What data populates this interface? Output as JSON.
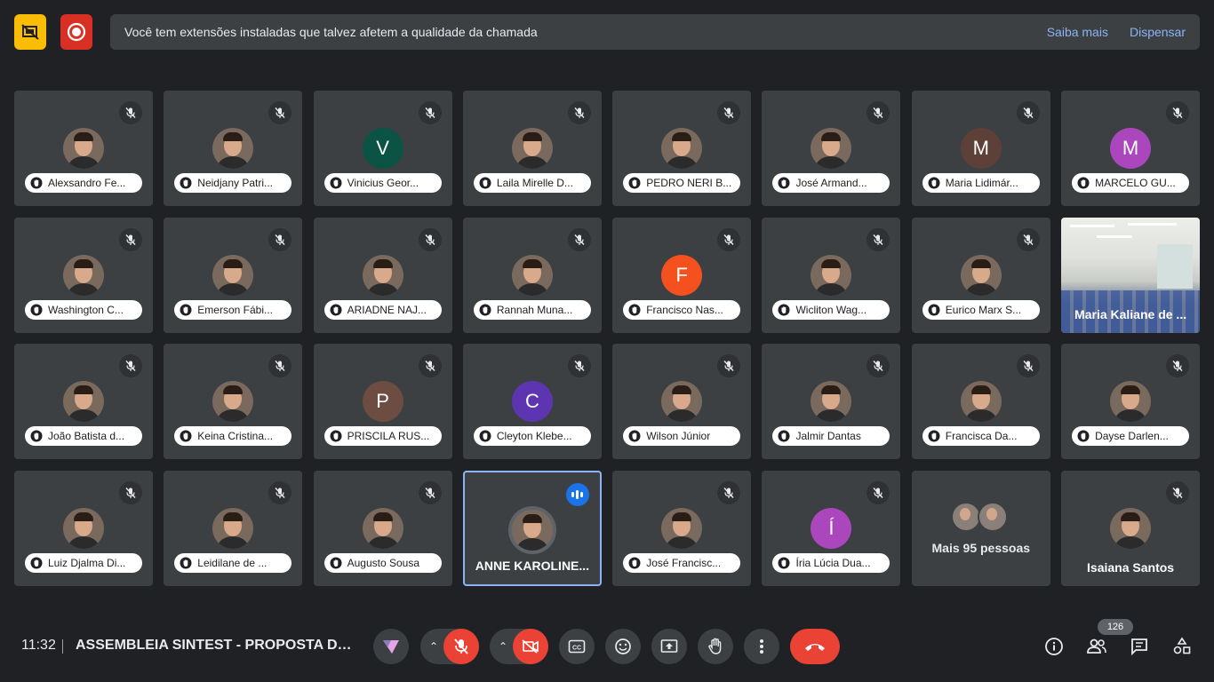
{
  "notice": {
    "text": "Você tem extensões instaladas que talvez afetem a qualidade da chamada",
    "learn_more": "Saiba mais",
    "dismiss": "Dispensar"
  },
  "participants": [
    {
      "name": "Alexsandro Fe...",
      "avatar": "photo",
      "muted": true
    },
    {
      "name": "Neidjany Patri...",
      "avatar": "photo",
      "muted": true
    },
    {
      "name": "Vinicius Geor...",
      "avatar": "letter",
      "letter": "V",
      "color": "#0b5345",
      "muted": true
    },
    {
      "name": "Laila Mirelle D...",
      "avatar": "photo",
      "muted": true
    },
    {
      "name": "PEDRO NERI B...",
      "avatar": "photo",
      "muted": true
    },
    {
      "name": "José Armand...",
      "avatar": "photo",
      "muted": true
    },
    {
      "name": "Maria Lidimár...",
      "avatar": "letter",
      "letter": "M",
      "color": "#5d4037",
      "muted": true
    },
    {
      "name": "MARCELO GU...",
      "avatar": "letter",
      "letter": "M",
      "color": "#ab47bc",
      "muted": true
    },
    {
      "name": "Washington C...",
      "avatar": "photo",
      "muted": true
    },
    {
      "name": "Emerson Fábi...",
      "avatar": "photo",
      "muted": true
    },
    {
      "name": "ARIADNE NAJ...",
      "avatar": "photo",
      "muted": true
    },
    {
      "name": "Rannah Muna...",
      "avatar": "photo",
      "muted": true
    },
    {
      "name": "Francisco Nas...",
      "avatar": "letter",
      "letter": "F",
      "color": "#f4511e",
      "muted": true
    },
    {
      "name": "Wicliton Wag...",
      "avatar": "photo",
      "muted": true
    },
    {
      "name": "Eurico Marx S...",
      "avatar": "photo",
      "muted": true
    },
    {
      "name": "Maria Kaliane de ...",
      "avatar": "video",
      "muted": false
    },
    {
      "name": "João Batista d...",
      "avatar": "photo",
      "muted": true
    },
    {
      "name": "Keina Cristina...",
      "avatar": "photo",
      "muted": true
    },
    {
      "name": "PRISCILA RUS...",
      "avatar": "letter",
      "letter": "P",
      "color": "#6d4c41",
      "muted": true
    },
    {
      "name": "Cleyton Klebe...",
      "avatar": "letter",
      "letter": "C",
      "color": "#5e35b1",
      "muted": true
    },
    {
      "name": "Wilson Júnior",
      "avatar": "photo",
      "muted": true
    },
    {
      "name": "Jalmir Dantas",
      "avatar": "photo",
      "muted": true
    },
    {
      "name": "Francisca Da...",
      "avatar": "photo",
      "muted": true
    },
    {
      "name": "Dayse Darlen...",
      "avatar": "photo",
      "muted": true
    },
    {
      "name": "Luiz Djalma Di...",
      "avatar": "photo",
      "muted": true
    },
    {
      "name": "Leidilane de ...",
      "avatar": "photo",
      "muted": true
    },
    {
      "name": "Augusto Sousa",
      "avatar": "photo",
      "muted": true
    },
    {
      "name": "ANNE KAROLINE...",
      "avatar": "photo",
      "speaking": true
    },
    {
      "name": "José Francisc...",
      "avatar": "photo",
      "muted": true
    },
    {
      "name": "Íria Lúcia Dua...",
      "avatar": "letter",
      "letter": "Í",
      "color": "#ab47bc",
      "muted": true
    },
    {
      "name": "Mais 95 pessoas",
      "avatar": "more"
    },
    {
      "name": "Isaiana Santos",
      "avatar": "photo",
      "muted": true,
      "plain": true
    }
  ],
  "bottom_bar": {
    "time": "11:32",
    "meeting_title": "ASSEMBLEIA SINTEST - PROPOSTA DO G...",
    "participant_count": "126"
  },
  "colors": {
    "background": "#202124",
    "tile": "#3c4043",
    "accent": "#8ab4f8",
    "danger": "#ea4335"
  },
  "icons": {
    "warning": "extension-warning-icon",
    "record": "recording-icon",
    "mic_off": "mic-off-icon",
    "cam_off": "camera-off-icon",
    "captions": "captions-icon",
    "emoji": "emoji-icon",
    "present": "present-screen-icon",
    "raise_hand": "raise-hand-icon",
    "more": "more-options-icon",
    "hang_up": "hang-up-icon",
    "info": "info-icon",
    "people": "people-icon",
    "chat": "chat-icon",
    "activities": "activities-icon"
  }
}
